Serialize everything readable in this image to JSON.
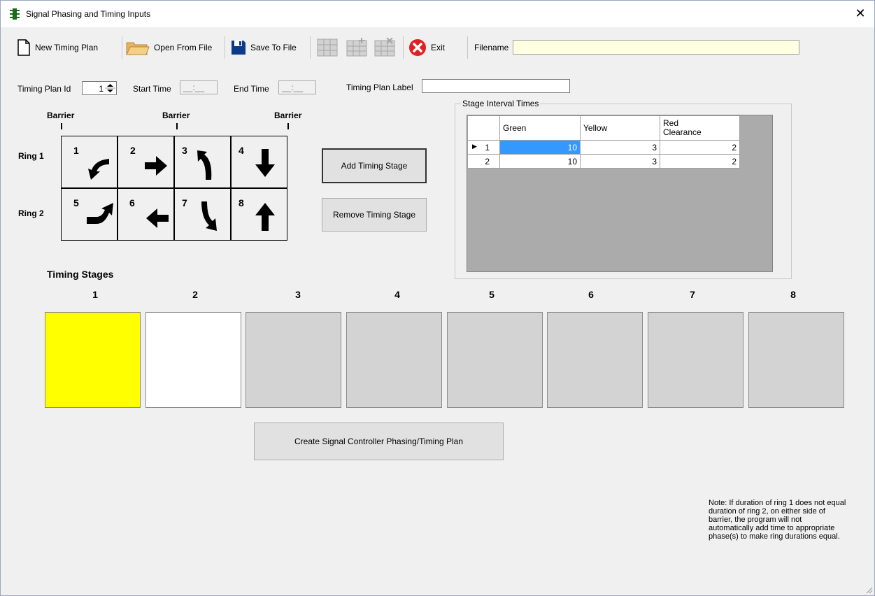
{
  "window": {
    "title": "Signal Phasing and Timing Inputs",
    "close_glyph": "✕",
    "icon": "traffic-light-icon"
  },
  "toolbar": {
    "new_label": "New Timing Plan",
    "open_label": "Open From File",
    "save_label": "Save To File",
    "exit_label": "Exit",
    "filename_label": "Filename",
    "filename_value": ""
  },
  "plan": {
    "id_label": "Timing Plan Id",
    "id_value": "1",
    "start_label": "Start Time",
    "start_value": "__:__",
    "end_label": "End Time",
    "end_value": "__:__",
    "label_label": "Timing Plan Label",
    "label_value": ""
  },
  "barriers": [
    "Barrier",
    "Barrier",
    "Barrier"
  ],
  "rings": [
    "Ring 1",
    "Ring 2"
  ],
  "phases": [
    {
      "num": "1",
      "icon": "left-turn-arrow-icon"
    },
    {
      "num": "2",
      "icon": "right-arrow-icon"
    },
    {
      "num": "3",
      "icon": "left-turn-up-arrow-icon"
    },
    {
      "num": "4",
      "icon": "down-arrow-icon"
    },
    {
      "num": "5",
      "icon": "right-turn-up-arrow-icon"
    },
    {
      "num": "6",
      "icon": "left-arrow-icon"
    },
    {
      "num": "7",
      "icon": "right-turn-down-arrow-icon"
    },
    {
      "num": "8",
      "icon": "up-arrow-icon"
    }
  ],
  "buttons": {
    "add_stage": "Add Timing Stage",
    "remove_stage": "Remove Timing Stage",
    "create_plan": "Create Signal Controller Phasing/Timing Plan"
  },
  "interval": {
    "group_title": "Stage Interval Times",
    "headers": [
      "Green",
      "Yellow",
      "Red Clearance"
    ],
    "rows": [
      {
        "id": "1",
        "green": "10",
        "yellow": "3",
        "red": "2"
      },
      {
        "id": "2",
        "green": "10",
        "yellow": "3",
        "red": "2"
      }
    ]
  },
  "stages": {
    "title": "Timing Stages",
    "numbers": [
      "1",
      "2",
      "3",
      "4",
      "5",
      "6",
      "7",
      "8"
    ],
    "colors": [
      "#ffff00",
      "#ffffff",
      "#d3d3d3",
      "#d3d3d3",
      "#d3d3d3",
      "#d3d3d3",
      "#d3d3d3",
      "#d3d3d3"
    ]
  },
  "note": "Note: If duration of ring 1 does not equal duration of ring 2, on either side of barrier, the program will not automatically add time to appropriate phase(s) to make ring durations equal."
}
